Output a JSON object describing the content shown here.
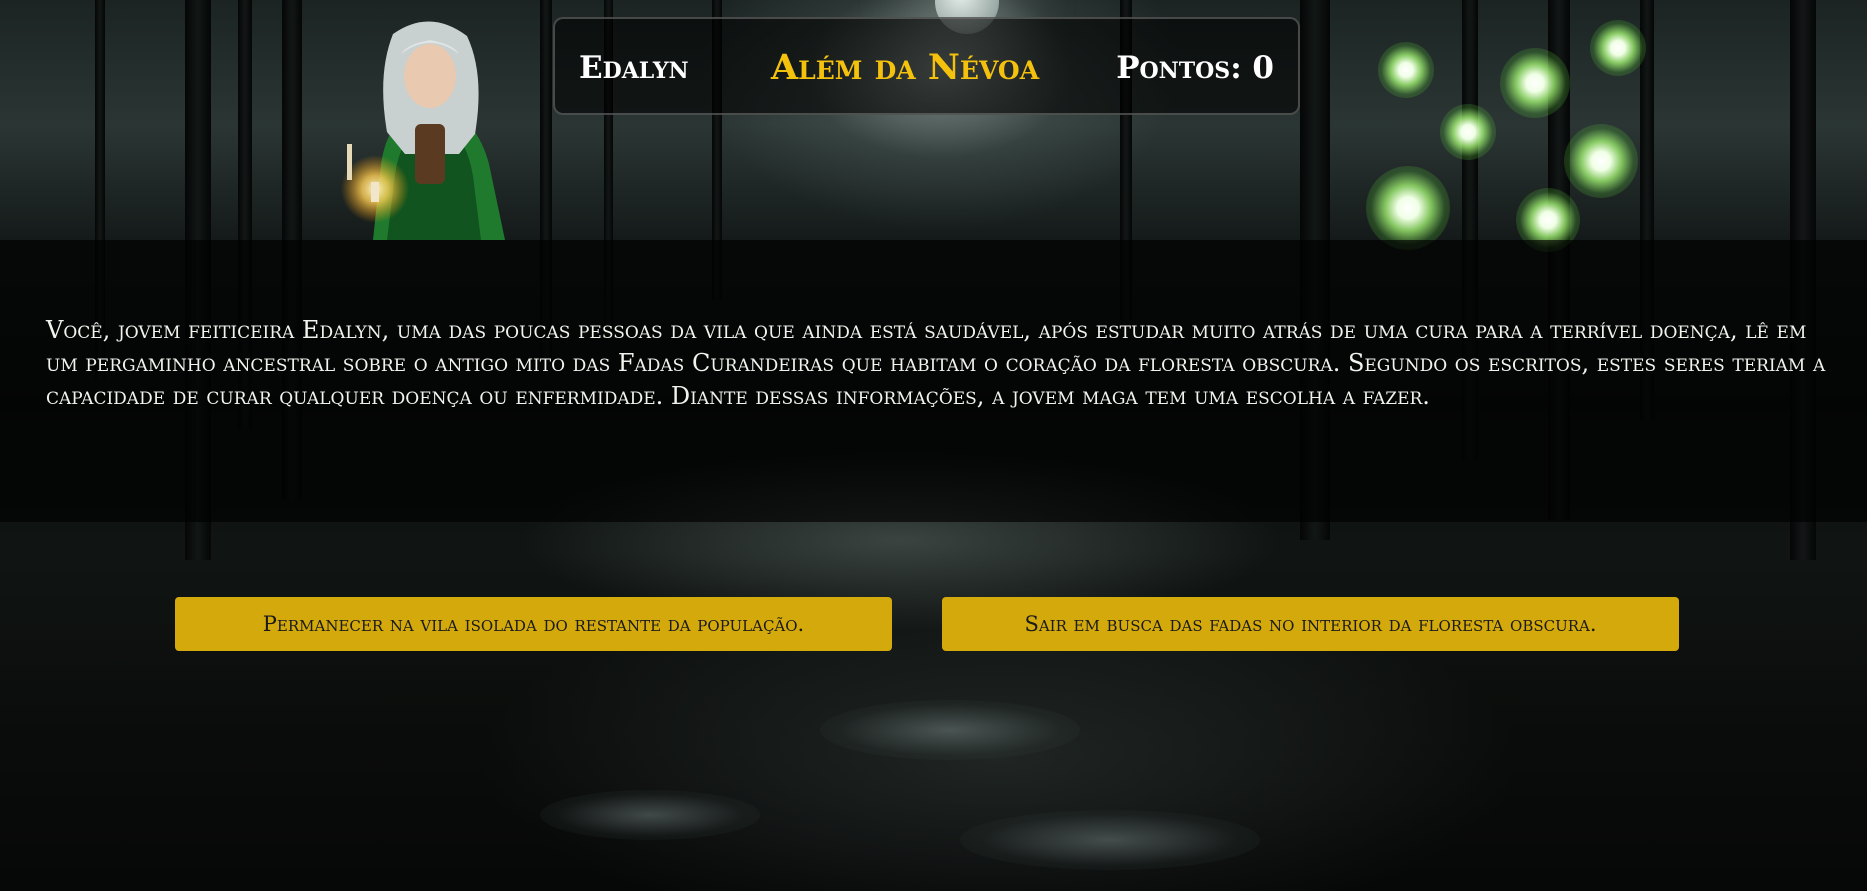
{
  "header": {
    "character_name": "Edalyn",
    "title": "Além da Névoa",
    "points_label": "Pontos: 0"
  },
  "story": {
    "text": "Você, jovem feiticeira Edalyn, uma das poucas pessoas da vila que ainda está saudável, após estudar muito atrás de uma cura para a terrível doença, lê em um pergaminho ancestral sobre o antigo mito das Fadas Curandeiras que habitam o coração da floresta obscura. Segundo os escritos, estes seres teriam a capacidade de curar qualquer doença ou enfermidade. Diante dessas informações, a jovem maga tem uma escolha a fazer."
  },
  "choices": [
    {
      "label": "Permanecer na vila isolada do restante da população."
    },
    {
      "label": "Sair em busca das fadas no interior da floresta obscura."
    }
  ],
  "colors": {
    "title_gold": "#f4c20d",
    "button_gold": "#d4a90b",
    "text_white": "#f2f2ee"
  }
}
